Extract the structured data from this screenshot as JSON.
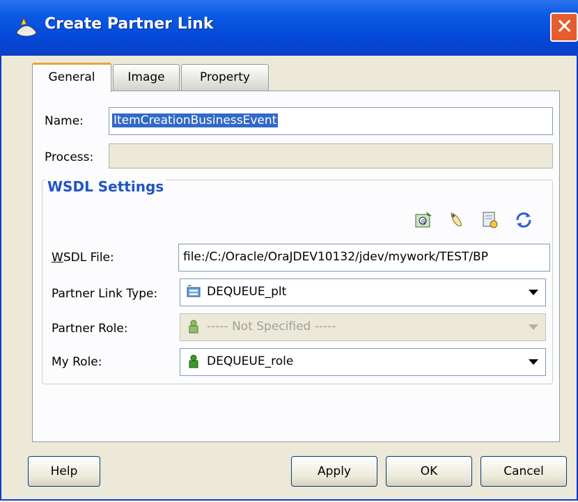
{
  "window": {
    "title": "Create Partner Link"
  },
  "tabs": [
    {
      "label": "General",
      "active": true
    },
    {
      "label": "Image",
      "active": false
    },
    {
      "label": "Property",
      "active": false
    }
  ],
  "general": {
    "name_label": "Name:",
    "name_value": "ItemCreationBusinessEvent",
    "process_label": "Process:",
    "process_value": ""
  },
  "wsdl": {
    "group_label": "WSDL Settings",
    "toolbar_icons": [
      "service-explorer-icon",
      "define-adapter-icon",
      "browse-wsdl-icon",
      "refresh-icon"
    ],
    "wsdl_file_label": "WSDL File:",
    "wsdl_file_value": "file:/C:/Oracle/OraJDEV10132/jdev/mywork/TEST/BP",
    "partner_link_type_label": "Partner Link Type:",
    "partner_link_type_value": "DEQUEUE_plt",
    "partner_role_label": "Partner Role:",
    "partner_role_value": "----- Not Specified -----",
    "my_role_label": "My Role:",
    "my_role_value": "DEQUEUE_role"
  },
  "buttons": {
    "help": "Help",
    "apply": "Apply",
    "ok": "OK",
    "cancel": "Cancel"
  },
  "colors": {
    "title_bar": "#0448d6",
    "accent_blue": "#2155c4",
    "selection": "#3169c6",
    "close_button": "#e65c2e"
  }
}
